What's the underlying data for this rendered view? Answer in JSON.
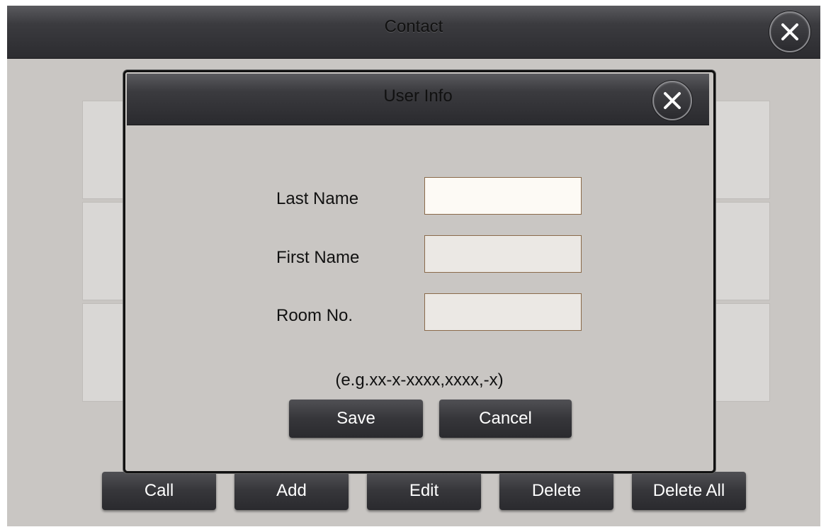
{
  "main": {
    "title": "Contact",
    "toolbar": {
      "call": "Call",
      "add": "Add",
      "edit": "Edit",
      "delete": "Delete",
      "delete_all": "Delete All"
    }
  },
  "dialog": {
    "title": "User Info",
    "fields": {
      "last_name_label": "Last Name",
      "last_name_value": "",
      "first_name_label": "First Name",
      "first_name_value": "",
      "room_no_label": "Room No.",
      "room_no_value": ""
    },
    "hint": "(e.g.xx-x-xxxx,xxxx,-x)",
    "save": "Save",
    "cancel": "Cancel"
  },
  "icons": {
    "main_close": "close-icon",
    "dialog_close": "close-icon"
  },
  "colors": {
    "background": "#c9c6c3",
    "titlebar": "#3b3b3f",
    "button": "#36363a",
    "button_text": "#ffffff",
    "input_active": "#fdfaf5",
    "input": "#ebe8e4"
  }
}
